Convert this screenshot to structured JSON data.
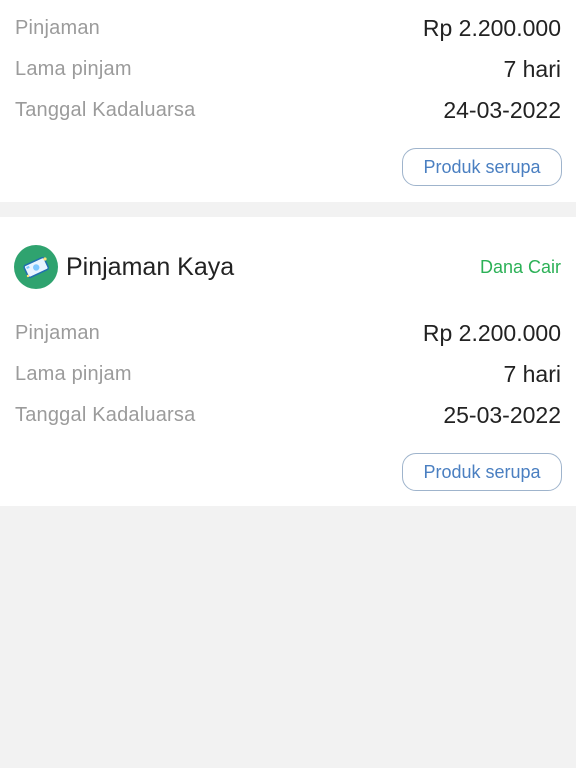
{
  "top_card": {
    "rows": [
      {
        "label": "Pinjaman",
        "value": "Rp 2.200.000"
      },
      {
        "label": "Lama pinjam",
        "value": "7 hari"
      },
      {
        "label": "Tanggal Kadaluarsa",
        "value": "24-03-2022"
      }
    ],
    "button_label": "Produk serupa"
  },
  "bottom_card": {
    "brand_name": "Pinjaman Kaya",
    "logo_icon": "money-icon",
    "status": "Dana Cair",
    "rows": [
      {
        "label": "Pinjaman",
        "value": "Rp 2.200.000"
      },
      {
        "label": "Lama pinjam",
        "value": "7 hari"
      },
      {
        "label": "Tanggal Kadaluarsa",
        "value": "25-03-2022"
      }
    ],
    "button_label": "Produk serupa"
  },
  "colors": {
    "status_green": "#2cb157",
    "button_blue": "#4a7fc1",
    "logo_green": "#2fa36f"
  }
}
